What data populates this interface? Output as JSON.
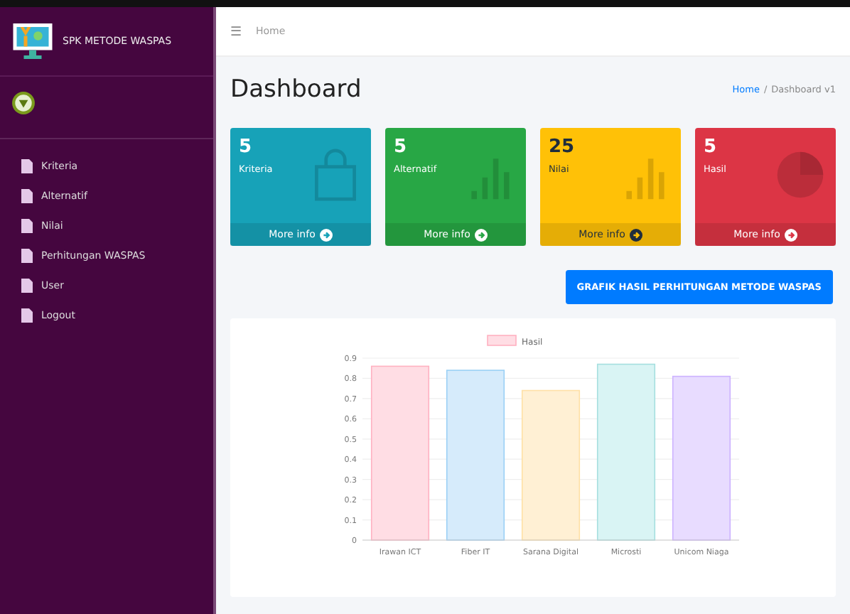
{
  "sidebar": {
    "brand": "SPK METODE WASPAS",
    "items": [
      {
        "label": "Kriteria"
      },
      {
        "label": "Alternatif"
      },
      {
        "label": "Nilai"
      },
      {
        "label": "Perhitungan WASPAS"
      },
      {
        "label": "User"
      },
      {
        "label": "Logout"
      }
    ]
  },
  "topbar": {
    "menu_icon": "☰",
    "link": "Home"
  },
  "header": {
    "title": "Dashboard",
    "breadcrumb": [
      "Home",
      "Dashboard v1"
    ],
    "breadcrumb_separator": "/"
  },
  "cards": [
    {
      "count": "5",
      "label": "Kriteria",
      "footer": "More info",
      "kind": "bag",
      "color": "#17a2b8"
    },
    {
      "count": "5",
      "label": "Alternatif",
      "footer": "More info",
      "kind": "bars",
      "color": "#28a745"
    },
    {
      "count": "25",
      "label": "Nilai",
      "footer": "More info",
      "kind": "bars",
      "color": "#ffc107"
    },
    {
      "count": "5",
      "label": "Hasil",
      "footer": "More info",
      "kind": "pie",
      "color": "#dc3545"
    }
  ],
  "action_button": "GRAFIK HASIL PERHITUNGAN METODE WASPAS",
  "chart_data": {
    "type": "bar",
    "categories": [
      "Irawan ICT",
      "Fiber IT",
      "Sarana Digital",
      "Microsti",
      "Unicom Niaga"
    ],
    "grid": true,
    "series": [
      {
        "name": "Hasil",
        "color": "#ffdde4",
        "colors": [
          "#ffdde4",
          "#d6ebfb",
          "#fff0d4",
          "#d9f4f4",
          "#e8dcff"
        ],
        "values": [
          0.86,
          0.84,
          0.74,
          0.87,
          0.81
        ]
      }
    ],
    "ylim": [
      0,
      0.9
    ],
    "yticks": [
      0,
      0.1,
      0.2,
      0.3,
      0.4,
      0.5,
      0.6,
      0.7,
      0.8,
      0.9
    ]
  }
}
